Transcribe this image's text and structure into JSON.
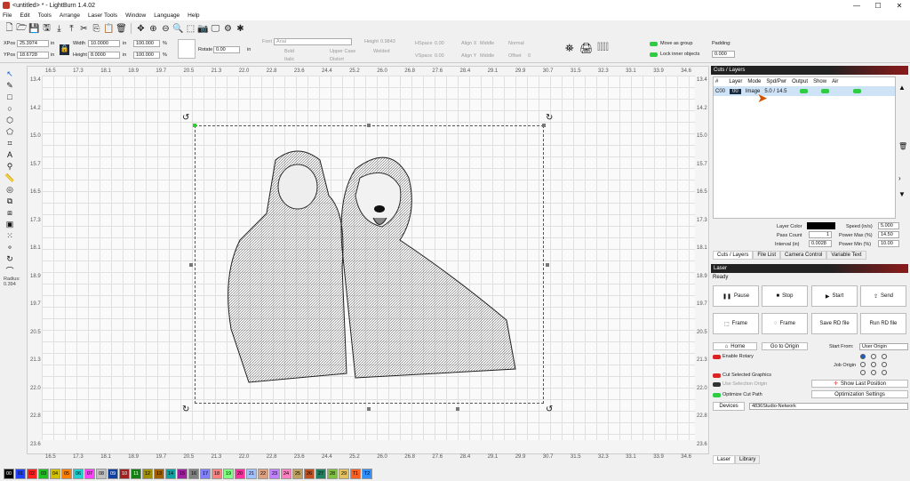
{
  "window": {
    "title": "<untitled> * - LightBurn 1.4.02",
    "minimize": "—",
    "maximize": "☐",
    "close": "✕"
  },
  "menu": [
    "File",
    "Edit",
    "Tools",
    "Arrange",
    "Laser Tools",
    "Window",
    "Language",
    "Help"
  ],
  "props": {
    "xpos_label": "XPos",
    "xpos": "25.3974",
    "ypos_label": "YPos",
    "ypos": "18.6728",
    "unit": "in",
    "width_label": "Width",
    "width": "10.0000",
    "height_label": "Height",
    "height": "8.0000",
    "wpct": "100.000",
    "hpct": "100.000",
    "pct": "%",
    "rotate_label": "Rotate",
    "rotate": "0.00",
    "font_label": "Font",
    "font": "Arial",
    "fheight_label": "Height",
    "fheight": "0.9843",
    "hspace_label": "HSpace",
    "hspace": "0.00",
    "vspace_label": "VSpace",
    "vspace": "0.00",
    "alignx_label": "Align X",
    "alignx": "Middle",
    "aligny_label": "Align Y",
    "aligny": "Middle",
    "normal": "Normal",
    "offset_label": "Offset",
    "offset": "0",
    "bold": "Bold",
    "italic": "Italic",
    "upper": "Upper Case",
    "distort": "Distort",
    "welded": "Welded",
    "move_group": "Move as group",
    "lock_inner": "Lock inner objects",
    "padding_label": "Padding:",
    "padding": "0.000"
  },
  "ruler_h": [
    "16.5",
    "17.3",
    "18.1",
    "18.9",
    "19.7",
    "20.5",
    "21.3",
    "22.0",
    "22.8",
    "23.6",
    "24.4",
    "25.2",
    "26.0",
    "26.8",
    "27.6",
    "28.4",
    "29.1",
    "29.9",
    "30.7",
    "31.5",
    "32.3",
    "33.1",
    "33.9",
    "34.6"
  ],
  "ruler_v": [
    "13.4",
    "14.2",
    "15.0",
    "15.7",
    "16.5",
    "17.3",
    "18.1",
    "18.9",
    "19.7",
    "20.5",
    "21.3",
    "22.0",
    "22.8",
    "23.6"
  ],
  "radius": {
    "label": "Radius:",
    "value": "0.394"
  },
  "cuts": {
    "title": "Cuts / Layers",
    "headers": [
      "#",
      "Layer",
      "Mode",
      "Spd/Pwr",
      "Output",
      "Show",
      "Air"
    ],
    "row": {
      "num": "C00",
      "layer": "00",
      "mode": "Image",
      "spdpwr": "5.0 / 14.5"
    },
    "layer_color_label": "Layer Color",
    "speed_label": "Speed (in/s)",
    "speed": "5.000",
    "pass_label": "Pass Count",
    "pass": "1",
    "powermax_label": "Power Max (%)",
    "powermax": "14.50",
    "interval_label": "Interval (in)",
    "interval": "0.0028",
    "powermin_label": "Power Min (%)",
    "powermin": "10.00",
    "layer_color": "#000000"
  },
  "tabs1": [
    "Cuts / Layers",
    "File List",
    "Camera Control",
    "Variable Text"
  ],
  "laser": {
    "title": "Laser",
    "status": "Ready",
    "pause": "Pause",
    "stop": "Stop",
    "start": "Start",
    "send": "Send",
    "frame1": "Frame",
    "frame2": "Frame",
    "save_rd": "Save RD file",
    "run_rd": "Run RD file",
    "home": "Home",
    "goto_origin": "Go to Origin",
    "start_from_label": "Start From:",
    "start_from": "User Origin",
    "enable_rotary": "Enable Rotary",
    "job_origin": "Job Origin",
    "cut_selected": "Cut Selected Graphics",
    "use_selection": "Use Selection Origin",
    "show_last": "Show Last Position",
    "optimize": "Optimize Cut Path",
    "opt_settings": "Optimization Settings",
    "devices": "Devices",
    "device": "4836Studio-Network"
  },
  "tabs2": [
    "Laser",
    "Library"
  ],
  "palette": [
    {
      "label": "00",
      "color": "#000000"
    },
    {
      "label": "01",
      "color": "#1f3fff"
    },
    {
      "label": "02",
      "color": "#ff2020"
    },
    {
      "label": "03",
      "color": "#20c020"
    },
    {
      "label": "04",
      "color": "#d0c000"
    },
    {
      "label": "05",
      "color": "#ff8000"
    },
    {
      "label": "06",
      "color": "#20d0d0"
    },
    {
      "label": "07",
      "color": "#ff40ff"
    },
    {
      "label": "08",
      "color": "#c0c0c0"
    },
    {
      "label": "09",
      "color": "#1040a0"
    },
    {
      "label": "10",
      "color": "#a02020"
    },
    {
      "label": "11",
      "color": "#108010"
    },
    {
      "label": "12",
      "color": "#a09000"
    },
    {
      "label": "13",
      "color": "#a06000"
    },
    {
      "label": "14",
      "color": "#10a0a0"
    },
    {
      "label": "15",
      "color": "#a020a0"
    },
    {
      "label": "16",
      "color": "#808080"
    },
    {
      "label": "17",
      "color": "#8080ff"
    },
    {
      "label": "18",
      "color": "#ff8080"
    },
    {
      "label": "19",
      "color": "#80ff80"
    },
    {
      "label": "20",
      "color": "#ff30a0"
    },
    {
      "label": "21",
      "color": "#a0c0ff"
    },
    {
      "label": "22",
      "color": "#e0a080"
    },
    {
      "label": "23",
      "color": "#c080ff"
    },
    {
      "label": "24",
      "color": "#ff80c0"
    },
    {
      "label": "25",
      "color": "#c0a060"
    },
    {
      "label": "26",
      "color": "#c05020"
    },
    {
      "label": "27",
      "color": "#208060"
    },
    {
      "label": "28",
      "color": "#80c040"
    },
    {
      "label": "29",
      "color": "#e0c060"
    },
    {
      "label": "T1",
      "color": "#ff6020"
    },
    {
      "label": "T2",
      "color": "#3090ff"
    }
  ]
}
